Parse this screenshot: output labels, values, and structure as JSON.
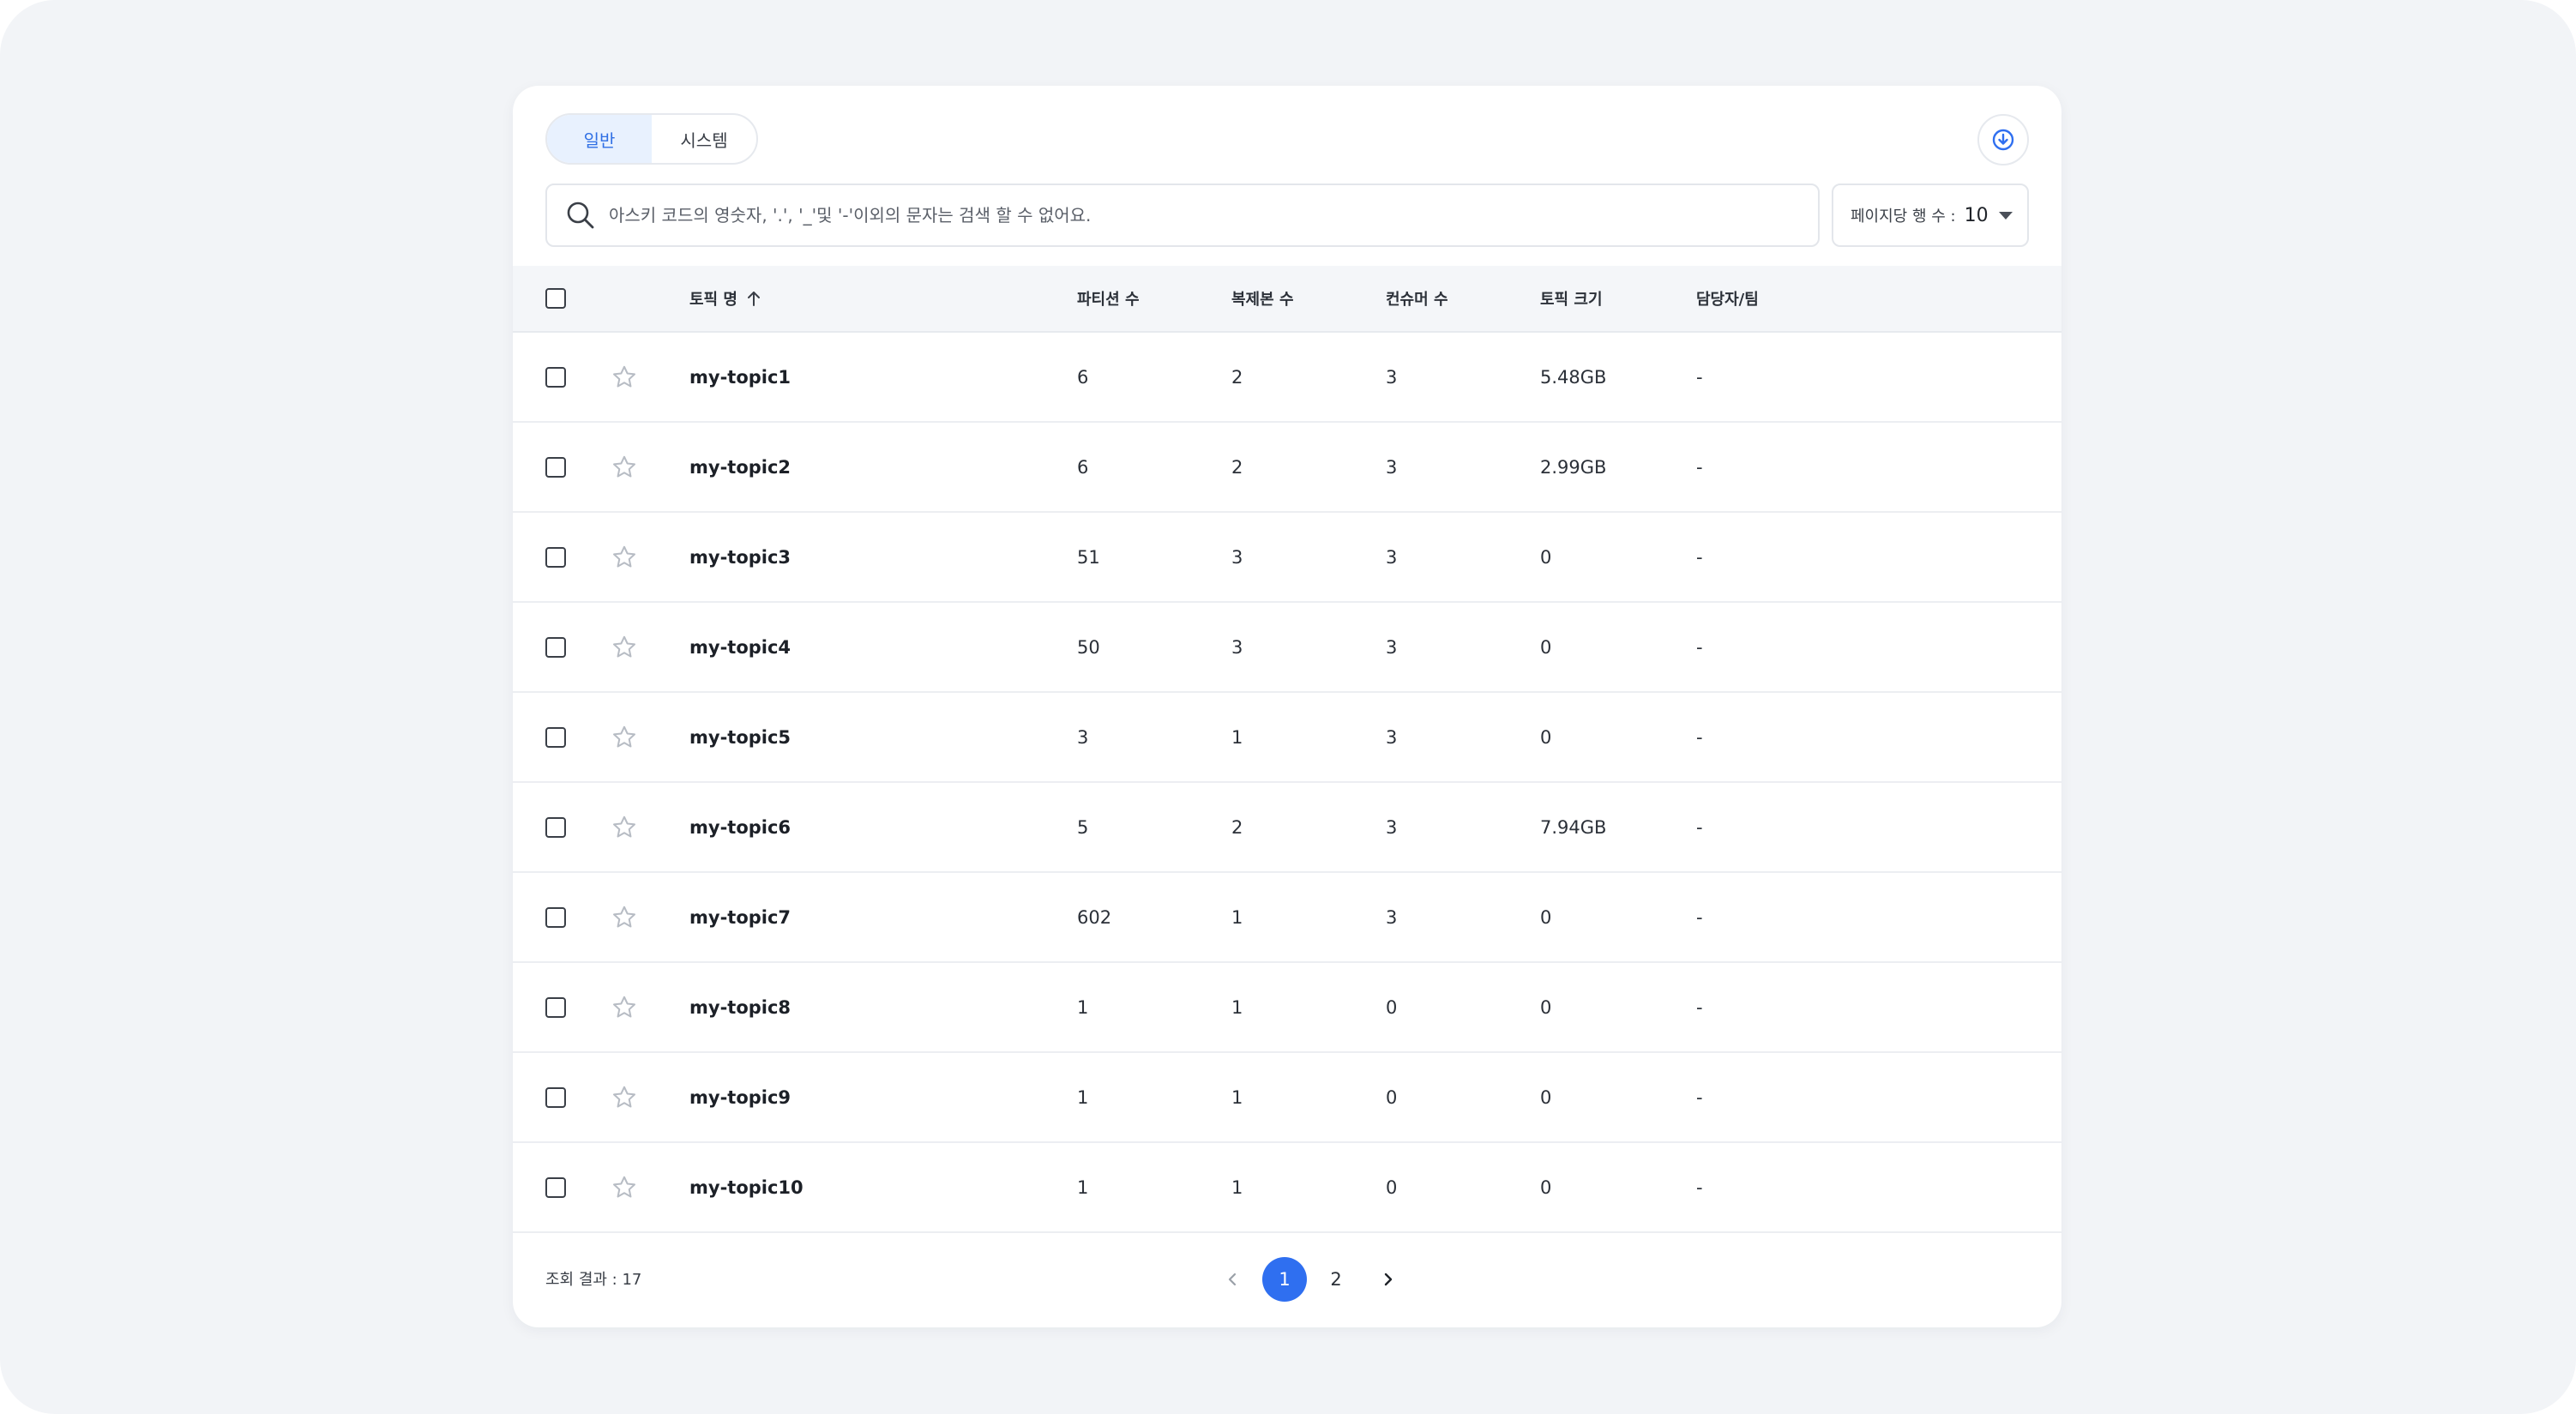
{
  "tabs": [
    {
      "label": "일반",
      "active": true
    },
    {
      "label": "시스템",
      "active": false
    }
  ],
  "download_icon": "download-circle-icon",
  "search": {
    "placeholder": "아스키 코드의 영숫자, '.', '_'및 '-'이외의 문자는 검색 할 수 없어요.",
    "value": ""
  },
  "rows_per_page": {
    "label": "페이지당 행 수 :",
    "value": "10"
  },
  "table": {
    "headers": {
      "name": "토픽 명",
      "partitions": "파티션 수",
      "replicas": "복제본 수",
      "consumers": "컨슈머 수",
      "size": "토픽 크기",
      "owner": "담당자/팀"
    },
    "sort": {
      "column": "name",
      "direction": "asc"
    },
    "rows": [
      {
        "name": "my-topic1",
        "partitions": "6",
        "replicas": "2",
        "consumers": "3",
        "size": "5.48GB",
        "owner": "-"
      },
      {
        "name": "my-topic2",
        "partitions": "6",
        "replicas": "2",
        "consumers": "3",
        "size": "2.99GB",
        "owner": "-"
      },
      {
        "name": "my-topic3",
        "partitions": "51",
        "replicas": "3",
        "consumers": "3",
        "size": "0",
        "owner": "-"
      },
      {
        "name": "my-topic4",
        "partitions": "50",
        "replicas": "3",
        "consumers": "3",
        "size": "0",
        "owner": "-"
      },
      {
        "name": "my-topic5",
        "partitions": "3",
        "replicas": "1",
        "consumers": "3",
        "size": "0",
        "owner": "-"
      },
      {
        "name": "my-topic6",
        "partitions": "5",
        "replicas": "2",
        "consumers": "3",
        "size": "7.94GB",
        "owner": "-"
      },
      {
        "name": "my-topic7",
        "partitions": "602",
        "replicas": "1",
        "consumers": "3",
        "size": "0",
        "owner": "-"
      },
      {
        "name": "my-topic8",
        "partitions": "1",
        "replicas": "1",
        "consumers": "0",
        "size": "0",
        "owner": "-"
      },
      {
        "name": "my-topic9",
        "partitions": "1",
        "replicas": "1",
        "consumers": "0",
        "size": "0",
        "owner": "-"
      },
      {
        "name": "my-topic10",
        "partitions": "1",
        "replicas": "1",
        "consumers": "0",
        "size": "0",
        "owner": "-"
      }
    ]
  },
  "footer": {
    "result_text": "조회 결과 : 17"
  },
  "pagination": {
    "pages": [
      "1",
      "2"
    ],
    "current": "1"
  },
  "colors": {
    "accent": "#2f6ff0",
    "tab_active_bg": "#e8f1fe",
    "background": "#f2f4f7"
  }
}
